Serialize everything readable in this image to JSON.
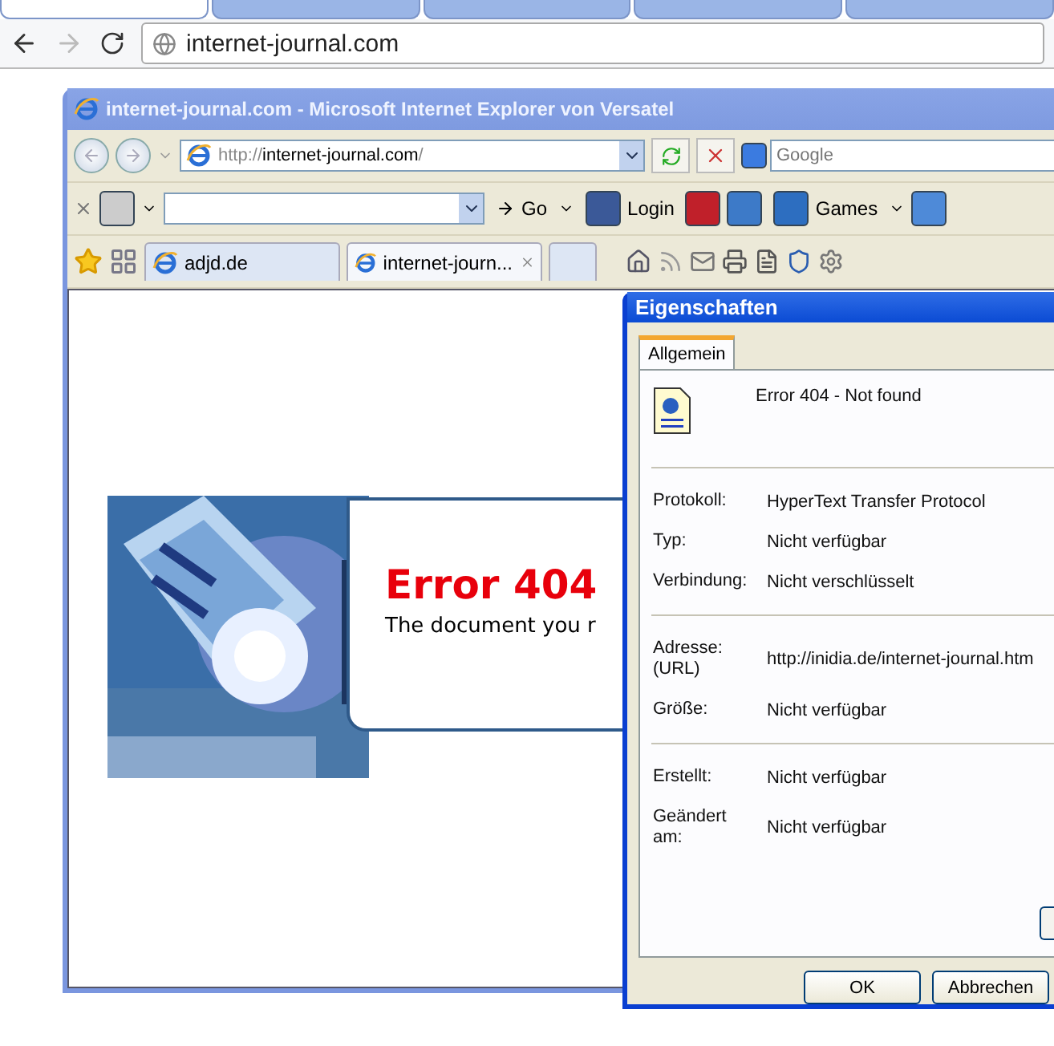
{
  "outer_browser": {
    "tabs": [
      {
        "selected": true
      },
      {
        "selected": false
      },
      {
        "selected": false
      },
      {
        "selected": false
      },
      {
        "selected": false
      }
    ],
    "address": "internet-journal.com"
  },
  "ie_window": {
    "title": "internet-journal.com - Microsoft Internet Explorer von Versatel",
    "address": {
      "scheme": "http://",
      "host": "internet-journal.com",
      "tail": "/"
    },
    "search": {
      "placeholder": "Google"
    },
    "toolbar": {
      "go": "Go",
      "login": "Login",
      "games": "Games"
    },
    "tabs": [
      {
        "label": "adjd.de",
        "selected": false
      },
      {
        "label": "internet-journ...",
        "selected": true
      }
    ],
    "page": {
      "heading": "Error 404",
      "text": "The document you r"
    }
  },
  "dialog": {
    "title": "Eigenschaften",
    "tabs": [
      {
        "label": "Allgemein",
        "selected": true
      }
    ],
    "doc_title": "Error 404 - Not found",
    "groups": [
      [
        {
          "label": "Protokoll:",
          "value": "HyperText Transfer Protocol"
        },
        {
          "label": "Typ:",
          "value": "Nicht verfügbar"
        },
        {
          "label": "Verbindung:",
          "value": "Nicht verschlüsselt"
        }
      ],
      [
        {
          "label": "Adresse: (URL)",
          "value": "http://inidia.de/internet-journal.htm"
        },
        {
          "label": "Größe:",
          "value": "Nicht verfügbar"
        }
      ],
      [
        {
          "label": "Erstellt:",
          "value": "Nicht verfügbar"
        },
        {
          "label": "Geändert am:",
          "value": "Nicht verfügbar"
        }
      ]
    ],
    "buttons": [
      "OK",
      "Abbrechen"
    ]
  }
}
